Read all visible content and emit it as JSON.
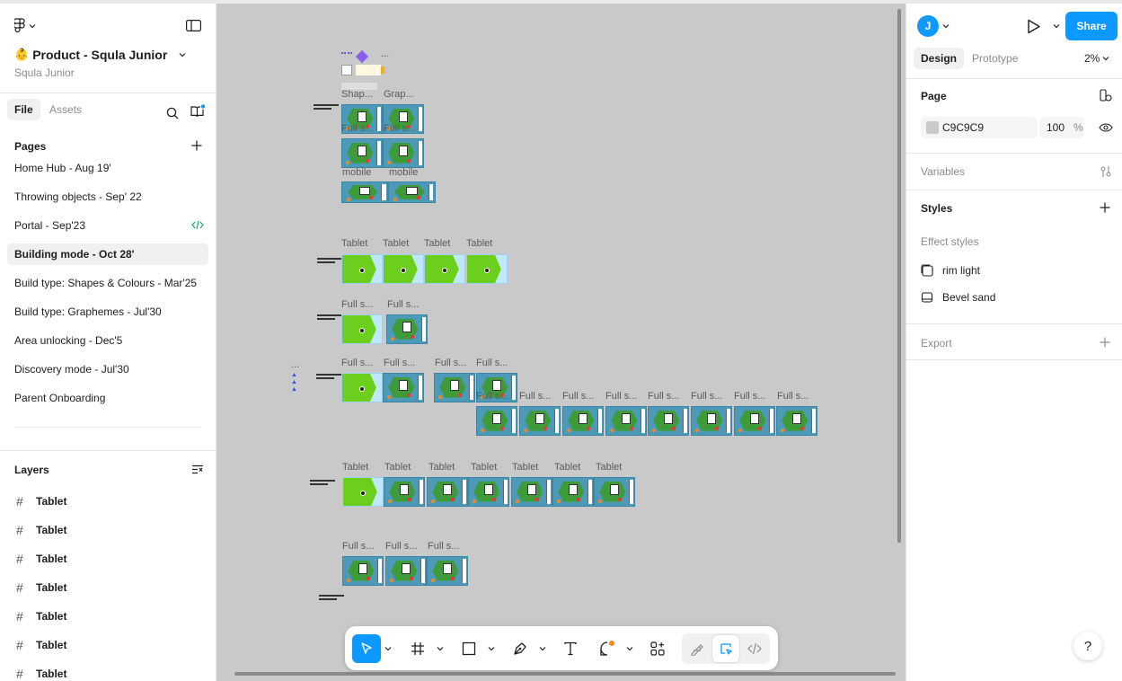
{
  "file": {
    "emoji": "👶",
    "title": "Product - Squla Junior",
    "team": "Squla Junior"
  },
  "left_tabs": {
    "file": "File",
    "assets": "Assets"
  },
  "pages": {
    "header": "Pages",
    "items": [
      "Home Hub - Aug 19'",
      "Throwing objects - Sep' 22",
      "Portal - Sep'23",
      "Building mode - Oct 28'",
      "Build type: Shapes & Colours - Mar'25",
      "Build type: Graphemes - Jul'30",
      "Area unlocking - Dec'5",
      "Discovery mode - Jul'30",
      "Parent Onboarding"
    ],
    "selected_index": 3
  },
  "layers": {
    "header": "Layers",
    "items": [
      "Tablet",
      "Tablet",
      "Tablet",
      "Tablet",
      "Tablet",
      "Tablet",
      "Tablet"
    ]
  },
  "canvas": {
    "background": "#C9C9C9",
    "labels": {
      "shap": "Shap...",
      "grap": "Grap...",
      "full_s": "Full s...",
      "full_s_dots": "Full s...",
      "mobile": "mobile",
      "tablet": "Tablet",
      "dots": "...",
      "full_ss": "Full s..."
    }
  },
  "right": {
    "avatar_letter": "J",
    "share_label": "Share",
    "tabs": {
      "design": "Design",
      "prototype": "Prototype"
    },
    "zoom": "2%",
    "page_section": "Page",
    "page_color": "C9C9C9",
    "page_opacity": "100",
    "percent": "%",
    "variables": "Variables",
    "styles": "Styles",
    "effect_styles_header": "Effect styles",
    "effect_styles": [
      "rim light",
      "Bevel sand"
    ],
    "export": "Export"
  },
  "help_label": "?",
  "colors": {
    "accent": "#0D99FF",
    "canvas": "#C9C9C9",
    "island": "#3F9A3A",
    "lime": "#6CCF1E"
  }
}
